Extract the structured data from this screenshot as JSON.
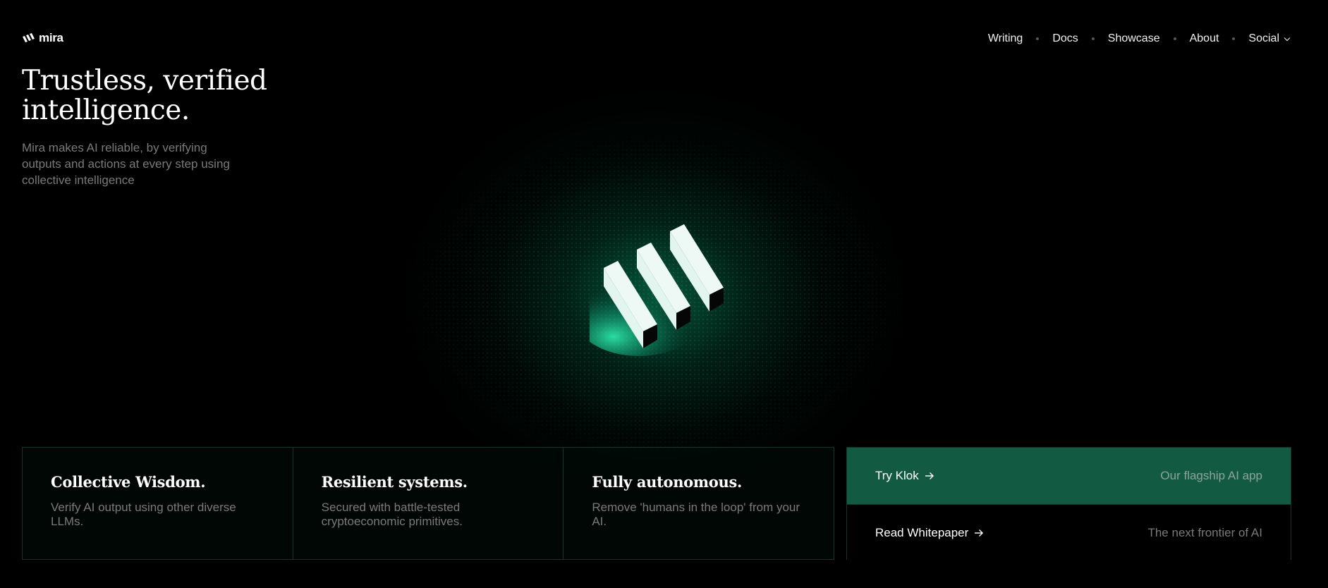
{
  "brand": {
    "name": "mira",
    "accent_color": "#135a43",
    "glow_color": "#0aa06e"
  },
  "nav": {
    "items": [
      {
        "label": "Writing"
      },
      {
        "label": "Docs"
      },
      {
        "label": "Showcase"
      },
      {
        "label": "About"
      },
      {
        "label": "Social",
        "icon": "chevron-down-icon"
      }
    ]
  },
  "hero": {
    "title": "Trustless, verified intelligence.",
    "subtitle": "Mira makes AI reliable, by verifying outputs and actions at every step using collective intelligence"
  },
  "features": [
    {
      "title": "Collective Wisdom.",
      "description": "Verify AI output using other diverse LLMs."
    },
    {
      "title": "Resilient systems.",
      "description": "Secured with battle-tested cryptoeconomic primitives."
    },
    {
      "title": "Fully autonomous.",
      "description": "Remove 'humans in the loop' from your AI."
    }
  ],
  "ctas": [
    {
      "label": "Try Klok",
      "icon": "arrow-right-icon",
      "caption": "Our flagship AI app"
    },
    {
      "label": "Read Whitepaper",
      "icon": "arrow-right-icon",
      "caption": "The next frontier of AI"
    }
  ]
}
